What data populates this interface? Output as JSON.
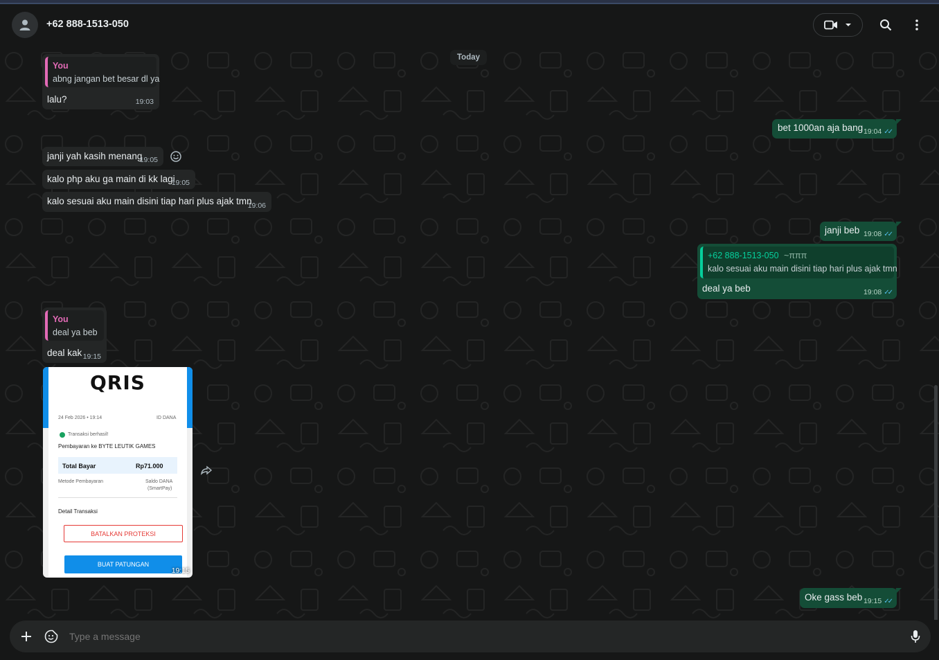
{
  "header": {
    "contact_name": "+62 888-1513-050",
    "video_call_icon": "video-camera-icon",
    "dropdown_icon": "chevron-down-icon",
    "search_icon": "search-icon",
    "menu_icon": "more-vertical-icon",
    "avatar_icon": "person-icon"
  },
  "chat": {
    "day_label": "Today",
    "messages": [
      {
        "direction": "in",
        "quote_author": "You",
        "quote_text": "abng jangan bet besar dl ya",
        "text": "lalu?",
        "time": "19:03"
      },
      {
        "direction": "out",
        "text": "bet 1000an aja bang",
        "time": "19:04"
      },
      {
        "direction": "in",
        "text": "janji yah kasih menang",
        "time": "19:05"
      },
      {
        "direction": "in",
        "text": "kalo php aku ga main di kk lagi",
        "time": "19:05"
      },
      {
        "direction": "in",
        "text": "kalo sesuai aku main disini tiap hari plus ajak tmn",
        "time": "19:06"
      },
      {
        "direction": "out",
        "text": "janji beb",
        "time": "19:08"
      },
      {
        "direction": "out",
        "quote_author": "+62 888-1513-050",
        "quote_author_suffix": "~πππ",
        "quote_text": "kalo sesuai aku main disini tiap hari plus ajak tmn",
        "text": "deal ya beb",
        "time": "19:08"
      },
      {
        "direction": "in",
        "quote_author": "You",
        "quote_text": "deal ya beb",
        "text": "deal kak",
        "time": "19:15"
      },
      {
        "direction": "in",
        "type": "image",
        "time": "19:15",
        "receipt": {
          "logo": "QRIS",
          "date": "24 Feb 2026 • 19:14",
          "id_label": "ID DANA",
          "status": "Transaksi berhasil!",
          "merchant": "Pembayaran ke BYTE LEUTIK GAMES",
          "total_label": "Total Bayar",
          "total_value": "Rp71.000",
          "method_label": "Metode Pembayaran",
          "method_value_1": "Saldo DANA",
          "method_value_2": "(SmartPay)",
          "detail_label": "Detail Transaksi",
          "cancel_button": "BATALKAN PROTEKSI",
          "split_button": "BUAT PATUNGAN"
        }
      },
      {
        "direction": "out",
        "text": "Oke gass beb",
        "time": "19:15"
      }
    ],
    "reaction_icon": "smiley-icon",
    "forward_icon": "forward-icon"
  },
  "composer": {
    "placeholder": "Type a message",
    "attach_icon": "plus-icon",
    "sticker_icon": "sticker-icon",
    "mic_icon": "microphone-icon"
  },
  "colors": {
    "background": "#161717",
    "incoming_bubble": "#242626",
    "outgoing_bubble": "#144d37",
    "accent_green": "#06cf9c",
    "quote_pink": "#e26ab6",
    "read_ticks": "#53bdeb"
  }
}
